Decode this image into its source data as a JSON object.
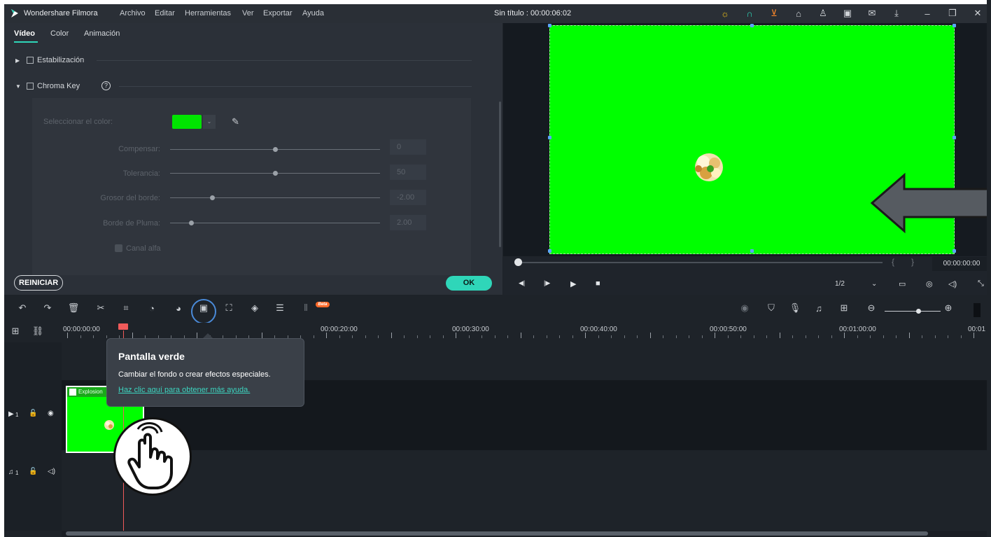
{
  "app": {
    "name": "Wondershare Filmora",
    "menu": [
      "Archivo",
      "Editar",
      "Herramientas",
      "Ver",
      "Exportar",
      "Ayuda"
    ],
    "document_title": "Sin título : 00:00:06:02"
  },
  "titlebar_icons": [
    "bulb-icon",
    "headset-icon",
    "cart-icon",
    "gift-icon",
    "user-icon",
    "save-icon",
    "mail-icon",
    "download-icon",
    "minimize-icon",
    "restore-icon",
    "close-icon"
  ],
  "panel": {
    "tabs": [
      "Vídeo",
      "Color",
      "Animación"
    ],
    "stabilization_label": "Estabilización",
    "chroma_key_label": "Chroma Key",
    "select_color_label": "Seleccionar el color:",
    "key_color": "#00e400",
    "sliders": [
      {
        "label": "Compensar:",
        "value": "0",
        "level": 0.5
      },
      {
        "label": "Tolerancia:",
        "value": "50",
        "level": 0.5
      },
      {
        "label": "Grosor del borde:",
        "value": "-2.00",
        "level": 0.2
      },
      {
        "label": "Borde de Pluma:",
        "value": "2.00",
        "level": 0.1
      }
    ],
    "alpha_label": "Canal alfa",
    "reset_label": "REINICIAR",
    "ok_label": "OK"
  },
  "preview": {
    "timecode": "00:00:00:00",
    "ratio": "1/2",
    "playback_progress": 0.0
  },
  "ruler": {
    "labels": [
      "00:00:00:00",
      "00:00:20:00",
      "00:00:30:00",
      "00:00:40:00",
      "00:00:50:00",
      "00:01:00:00",
      "00:01"
    ]
  },
  "tracks": {
    "video_label": "1",
    "audio_label": "1",
    "clip_name": "Explosion"
  },
  "tooltip": {
    "title": "Pantalla verde",
    "description": "Cambiar el fondo o crear efectos especiales.",
    "link": "Haz clic aquí para obtener más ayuda."
  },
  "toolbar": {
    "beta_label": "Beta"
  },
  "colors": {
    "accent": "#2fd6b9",
    "green_screen": "#00ff00",
    "playhead": "#f05a5a"
  }
}
